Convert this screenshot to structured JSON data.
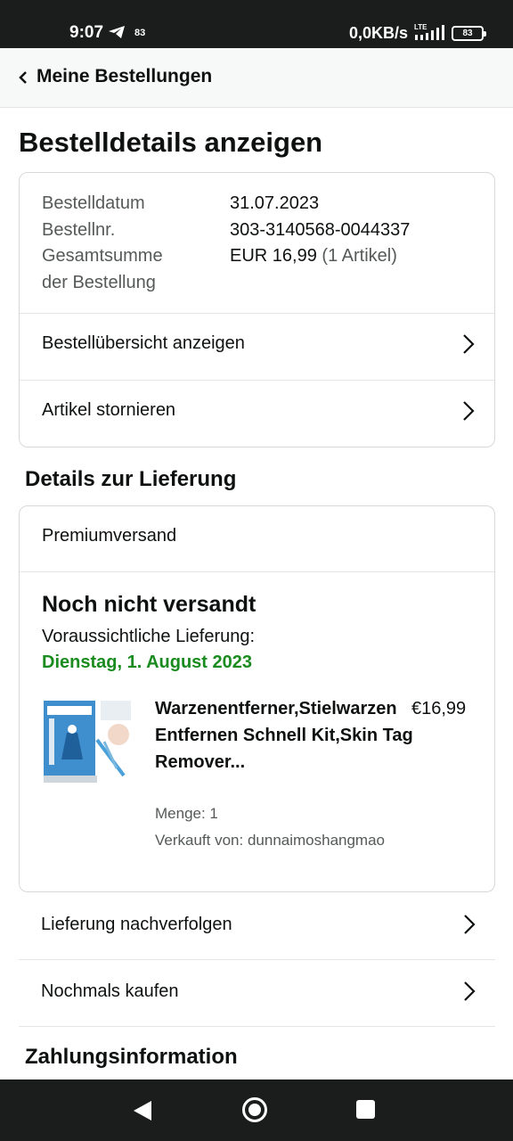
{
  "status_bar": {
    "time": "9:07",
    "notification_count": "83",
    "network_speed": "0,0KB/s",
    "network_type": "LTE",
    "battery": "83",
    "icons": [
      "telegram-icon",
      "signal-icon",
      "battery-icon"
    ]
  },
  "header": {
    "back_label": "Meine Bestellungen"
  },
  "page": {
    "title": "Bestelldetails anzeigen"
  },
  "order_summary": {
    "date_label": "Bestelldatum",
    "date_value": "31.07.2023",
    "number_label": "Bestellnr.",
    "number_value": "303-3140568-0044337",
    "total_label_line1": "Gesamtsumme",
    "total_label_line2": "der Bestellung",
    "total_value": "EUR 16,99",
    "total_items": "(1 Artikel)",
    "view_overview": "Bestellübersicht anzeigen",
    "cancel_items": "Artikel stornieren"
  },
  "delivery": {
    "section_title": "Details zur Lieferung",
    "shipping_method": "Premiumversand",
    "status": "Noch nicht versandt",
    "expected_label": "Voraussichtliche Lieferung:",
    "expected_date": "Dienstag, 1. August 2023",
    "expected_date_color": "#1a8b1f",
    "product": {
      "title": "Warzenentferner,Stielwarzen Entfernen Schnell Kit,Skin Tag Remover...",
      "price": "€16,99",
      "quantity": "Menge: 1",
      "seller": "Verkauft von: dunnaimoshangmao"
    }
  },
  "actions": {
    "track": "Lieferung nachverfolgen",
    "buy_again": "Nochmals kaufen"
  },
  "payment": {
    "section_title": "Zahlungsinformation"
  },
  "nav_bar": {
    "icons": [
      "back-icon",
      "home-icon",
      "recents-icon"
    ]
  }
}
